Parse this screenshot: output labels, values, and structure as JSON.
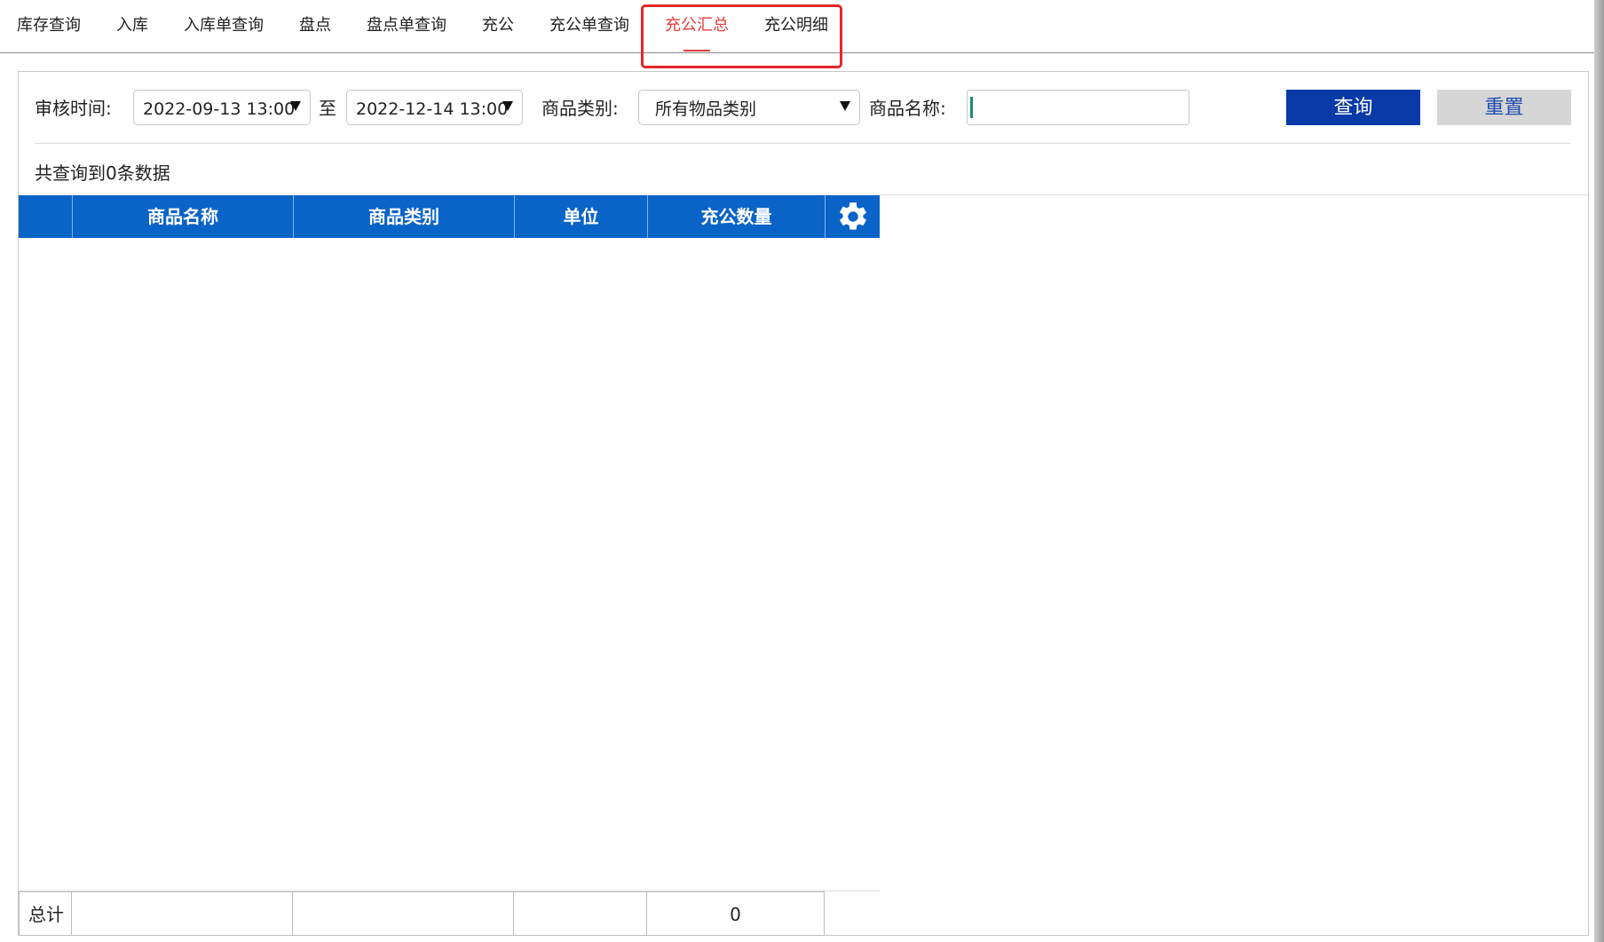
{
  "tabs": [
    {
      "label": "库存查询",
      "active": false
    },
    {
      "label": "入库",
      "active": false
    },
    {
      "label": "入库单查询",
      "active": false
    },
    {
      "label": "盘点",
      "active": false
    },
    {
      "label": "盘点单查询",
      "active": false
    },
    {
      "label": "充公",
      "active": false
    },
    {
      "label": "充公单查询",
      "active": false
    },
    {
      "label": "充公汇总",
      "active": true
    },
    {
      "label": "充公明细",
      "active": false
    }
  ],
  "filters": {
    "audit_time_label": "审核时间:",
    "start_time": "2022-09-13 13:00",
    "to_label": "至",
    "end_time": "2022-12-14 13:00",
    "category_label": "商品类别:",
    "category_value": "所有物品类别",
    "name_label": "商品名称:",
    "name_value": "",
    "name_placeholder": "",
    "query_button": "查询",
    "reset_button": "重置"
  },
  "result_count_text": "共查询到0条数据",
  "table": {
    "columns": [
      "",
      "商品名称",
      "商品类别",
      "单位",
      "充公数量"
    ],
    "settings_icon": "gear-icon",
    "rows": [],
    "footer": {
      "label": "总计",
      "name": "",
      "category": "",
      "unit": "",
      "quantity": "0"
    }
  },
  "colors": {
    "active_tab": "#e43d3d",
    "highlight_box": "#e4262a",
    "table_header": "#0a64c8",
    "query_button": "#0a3aa8",
    "reset_button_bg": "#d6d6d6",
    "reset_button_text": "#1e4fb0"
  }
}
